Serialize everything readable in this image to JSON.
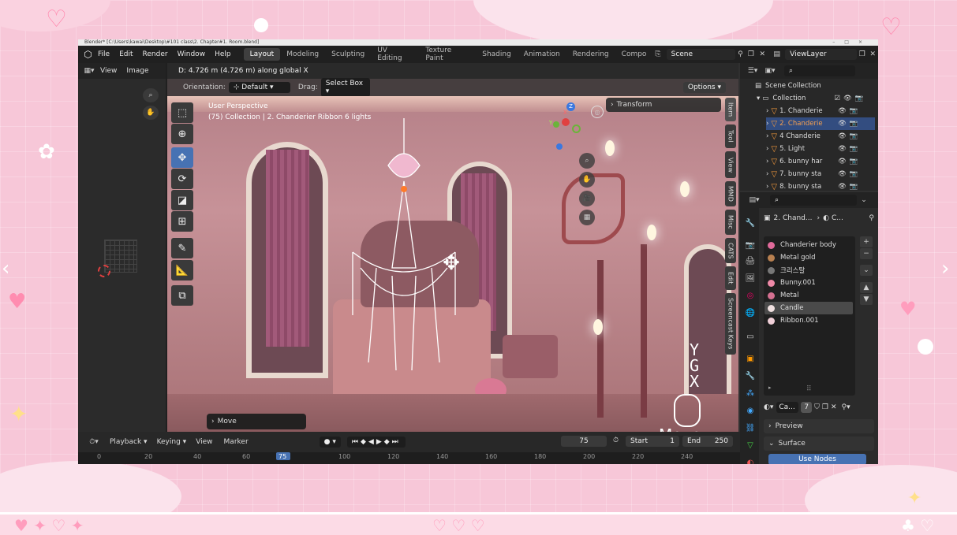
{
  "window": {
    "title": "Blender* [C:\\Users\\kawai\\Desktop\\#101 class\\2. Chapter#1. Room.blend]"
  },
  "menu": {
    "items": [
      "File",
      "Edit",
      "Render",
      "Window",
      "Help"
    ]
  },
  "workspaces": [
    "Layout",
    "Modeling",
    "Sculpting",
    "UV Editing",
    "Texture Paint",
    "Shading",
    "Animation",
    "Rendering",
    "Compo"
  ],
  "scene": {
    "name": "Scene",
    "viewlayer": "ViewLayer"
  },
  "left_editor": {
    "view": "View",
    "image": "Image"
  },
  "viewport": {
    "status": "D: 4.726 m (4.726 m) along global X",
    "orientation_label": "Orientation:",
    "orientation_value": "Default",
    "drag_label": "Drag:",
    "drag_value": "Select Box",
    "options": "Options",
    "perspective": "User Perspective",
    "collection_info": "(75) Collection | 2. Chanderier Ribbon 6 lights",
    "transform": "Transform",
    "move_panel": "Move",
    "overlay_keys": [
      "Y",
      "G",
      "X"
    ],
    "overlay_action": "Move",
    "gizmo_axes": {
      "z": "Z",
      "y": "Y",
      "x": "X"
    }
  },
  "side_tabs": [
    "Item",
    "Tool",
    "View",
    "MMD",
    "Misc",
    "CATS",
    "Edit",
    "Screencast Keys"
  ],
  "outliner": {
    "header": "Scene Collection",
    "collection": "Collection",
    "items": [
      "1. Chanderie",
      "2. Chanderie",
      "4 Chanderie",
      "5. Light",
      "6. bunny har",
      "7. bunny sta",
      "8. bunny sta"
    ]
  },
  "properties": {
    "breadcrumb": "2. Chand...",
    "breadcrumb_tail": "C...",
    "materials": [
      {
        "name": "Chanderier body",
        "color": "#e06a9a"
      },
      {
        "name": "Metal gold",
        "color": "#b88050"
      },
      {
        "name": "크리스탈",
        "color": "#777777"
      },
      {
        "name": "Bunny.001",
        "color": "#f08aa8"
      },
      {
        "name": "Metal",
        "color": "#d47090"
      },
      {
        "name": "Candle",
        "color": "#f0e0e0"
      },
      {
        "name": "Ribbon.001",
        "color": "#f0d0d8"
      }
    ],
    "slot_name": "Ca...",
    "users": "7",
    "preview": "Preview",
    "surface": "Surface",
    "use_nodes": "Use Nodes"
  },
  "timeline": {
    "menus": [
      "Playback",
      "Keying",
      "View",
      "Marker"
    ],
    "current_frame": "75",
    "start_label": "Start",
    "start": "1",
    "end_label": "End",
    "end": "250",
    "ruler": [
      "0",
      "20",
      "40",
      "60",
      "75",
      "100",
      "120",
      "140",
      "160",
      "180",
      "200",
      "220",
      "240"
    ]
  },
  "colors": {
    "accent": "#4772b3",
    "selected": "#334d80",
    "background": "#f7c7d8"
  }
}
